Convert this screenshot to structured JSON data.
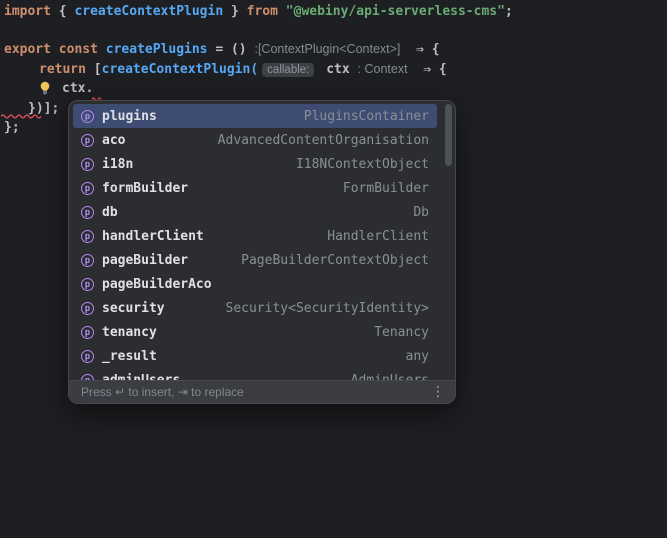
{
  "editor": {
    "lines": [
      {
        "tokens": [
          {
            "t": "import "
          },
          {
            "t": "{ "
          },
          {
            "t": "createContextPlugin"
          },
          {
            "t": " } "
          },
          {
            "t": "from "
          },
          {
            "t": "\"@webiny/api-serverless-cms\""
          },
          {
            "t": ";"
          }
        ]
      },
      {
        "tokens": [
          {
            "t": "export const "
          },
          {
            "t": "createPlugins"
          },
          {
            "t": " = () "
          },
          {
            "t": ":[ContextPlugin<Context>]"
          },
          {
            "t": "  ⇒ {"
          }
        ]
      },
      {
        "tokens": [
          {
            "t": "return "
          },
          {
            "t": "["
          },
          {
            "t": "createContextPlugin("
          },
          {
            "t": "callable:"
          },
          {
            "t": " ctx "
          },
          {
            "t": ": Context"
          },
          {
            "t": "  ⇒ {"
          }
        ]
      },
      {
        "tokens": [
          {
            "t": "ctx."
          }
        ]
      },
      {
        "tokens": [
          {
            "t": "})];"
          }
        ]
      },
      {
        "tokens": [
          {
            "t": "};"
          }
        ]
      }
    ]
  },
  "completion": {
    "icon_letter": "p",
    "items": [
      {
        "name": "plugins",
        "type": "PluginsContainer"
      },
      {
        "name": "aco",
        "type": "AdvancedContentOrganisation"
      },
      {
        "name": "i18n",
        "type": "I18NContextObject"
      },
      {
        "name": "formBuilder",
        "type": "FormBuilder"
      },
      {
        "name": "db",
        "type": "Db"
      },
      {
        "name": "handlerClient",
        "type": "HandlerClient"
      },
      {
        "name": "pageBuilder",
        "type": "PageBuilderContextObject"
      },
      {
        "name": "pageBuilderAco",
        "type": ""
      },
      {
        "name": "security",
        "type": "Security<SecurityIdentity>"
      },
      {
        "name": "tenancy",
        "type": "Tenancy"
      },
      {
        "name": "_result",
        "type": "any"
      },
      {
        "name": "adminUsers",
        "type": "AdminUsers"
      }
    ],
    "footer": {
      "hint": "Press ↵ to insert, ⇥ to replace",
      "more_icon": "⋮"
    }
  },
  "colors": {
    "background": "#1e1f22",
    "popup_bg": "#2b2d30",
    "selection": "#3e4c73",
    "keyword": "#cf8e6d",
    "function": "#56a8f5",
    "string": "#6aab73",
    "code_default": "#bcbec4",
    "inlay_hint": "#868a91",
    "type_text": "#8b8e95",
    "error_squiggle": "#f2545b",
    "property_icon": "#b78af0"
  }
}
